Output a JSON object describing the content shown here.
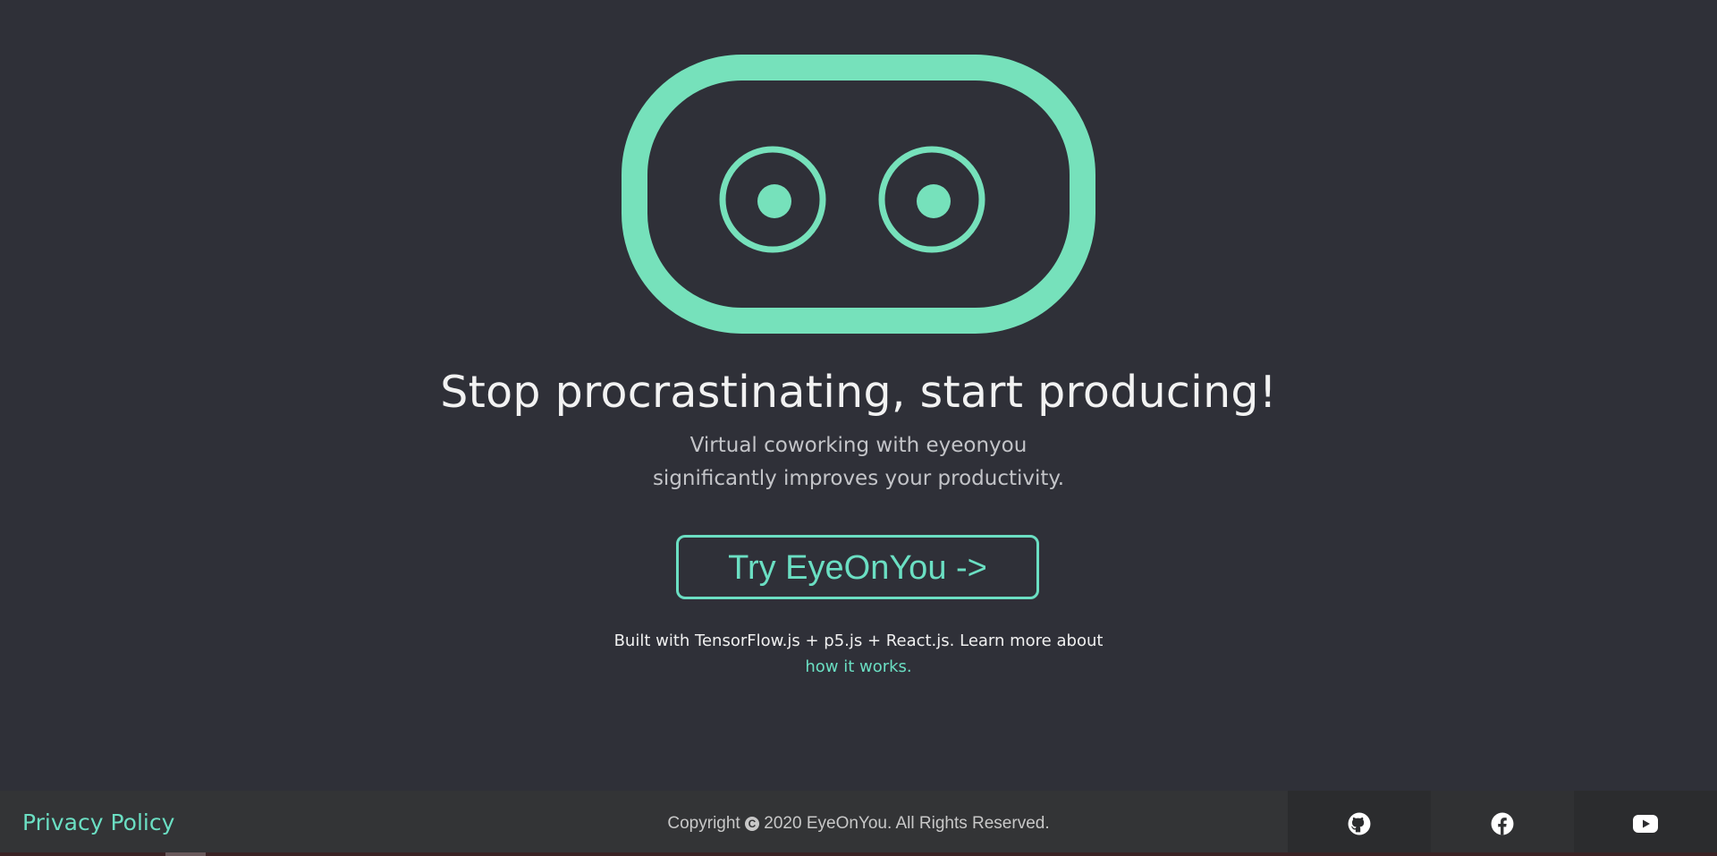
{
  "colors": {
    "accent": "#6bdfc3",
    "background": "#2f3038",
    "footer_background": "#333436"
  },
  "logo": {
    "icon": "robot-eyes-logo-icon"
  },
  "hero": {
    "headline": "Stop procrastinating, start producing!",
    "subline_1": "Virtual coworking with eyeonyou",
    "subline_2": "significantly improves your productivity.",
    "cta_label": "Try EyeOnYou ->",
    "built_with": "Built with TensorFlow.js + p5.js + React.js. Learn more about",
    "how_link": "how it works."
  },
  "footer": {
    "privacy_label": "Privacy Policy",
    "copyright_prefix": "Copyright",
    "copyright_text": "2020 EyeOnYou. All Rights Reserved.",
    "social": [
      {
        "name": "GitHub",
        "icon": "github-icon"
      },
      {
        "name": "Facebook",
        "icon": "facebook-icon"
      },
      {
        "name": "YouTube",
        "icon": "youtube-icon"
      }
    ]
  }
}
